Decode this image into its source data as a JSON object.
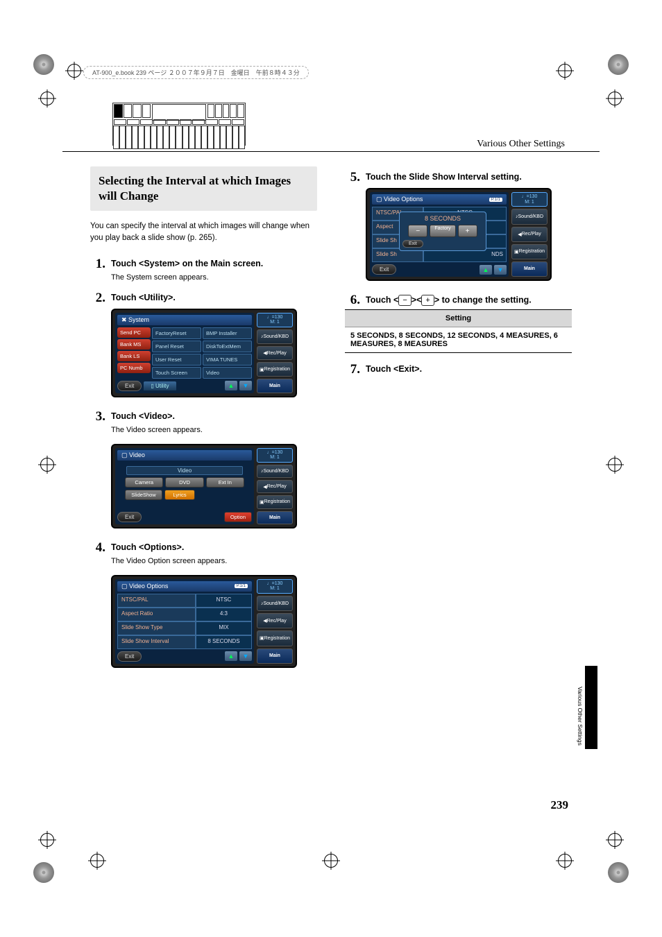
{
  "book_header": "AT-900_e.book  239 ページ  ２００７年９月７日　金曜日　午前８時４３分",
  "page_header": "Various Other Settings",
  "section_title": "Selecting the Interval at which Images will Change",
  "intro": "You can specify the interval at which images will change when you play back a slide show (p. 265).",
  "steps": {
    "s1": {
      "num": "1.",
      "text": "Touch <System> on the Main screen.",
      "note": "The System screen appears."
    },
    "s2": {
      "num": "2.",
      "text": "Touch <Utility>."
    },
    "s3": {
      "num": "3.",
      "text": "Touch <Video>.",
      "note": "The Video screen appears."
    },
    "s4": {
      "num": "4.",
      "text": "Touch <Options>.",
      "note": "The Video Option screen appears."
    },
    "s5": {
      "num": "5.",
      "text": "Touch the Slide Show Interval setting."
    },
    "s6": {
      "num": "6.",
      "text_pre": "Touch <",
      "minus": "−",
      "mid": "><",
      "plus": "+",
      "text_post": "> to change the setting."
    },
    "s7": {
      "num": "7.",
      "text": "Touch <Exit>."
    }
  },
  "screen_utility": {
    "title": "System",
    "left": [
      "Send PC",
      "Bank MS",
      "Bank LS",
      "PC Numb"
    ],
    "grid": [
      "FactoryReset",
      "BMP Installer",
      "Panel Reset",
      "DiskToExtMem",
      "User Reset",
      "VIMA TUNES",
      "Touch Screen",
      "Video"
    ],
    "exit": "Exit",
    "tab": "Utility"
  },
  "screen_video": {
    "title": "Video",
    "hdr": "Video",
    "buttons": [
      "Camera",
      "DVD",
      "Ext In",
      "SlideShow",
      "Lyrics"
    ],
    "exit": "Exit",
    "option": "Option"
  },
  "screen_options": {
    "title": "Video Options",
    "page": "P.1/1",
    "rows": [
      {
        "label": "NTSC/PAL",
        "val": "NTSC"
      },
      {
        "label": "Aspect Ratio",
        "val": "4:3"
      },
      {
        "label": "Slide Show Type",
        "val": "MIX"
      },
      {
        "label": "Slide Show Interval",
        "val": "8 SECONDS"
      }
    ],
    "exit": "Exit"
  },
  "screen_popup": {
    "title": "Video Options",
    "page": "P.1/1",
    "rows_bg": [
      "NTSC/PAL",
      "Aspect",
      "Slide Sh",
      "Slide Sh"
    ],
    "vals_bg": [
      "NTSC",
      "",
      "",
      "NDS"
    ],
    "popup_val": "8 SECONDS",
    "factory": "Factory",
    "minus": "−",
    "plus": "+",
    "pop_exit": "Exit",
    "exit": "Exit"
  },
  "side_panel": {
    "tempo": "♩=130",
    "m": "M:    1",
    "btns": [
      "Sound/KBD",
      "Rec/Play",
      "Registration",
      "Main"
    ]
  },
  "setting_table": {
    "header": "Setting",
    "row": "5 SECONDS, 8 SECONDS, 12 SECONDS, 4 MEASURES, 6 MEASURES, 8 MEASURES"
  },
  "side_tab_text": "Various Other Settings",
  "page_number": "239"
}
